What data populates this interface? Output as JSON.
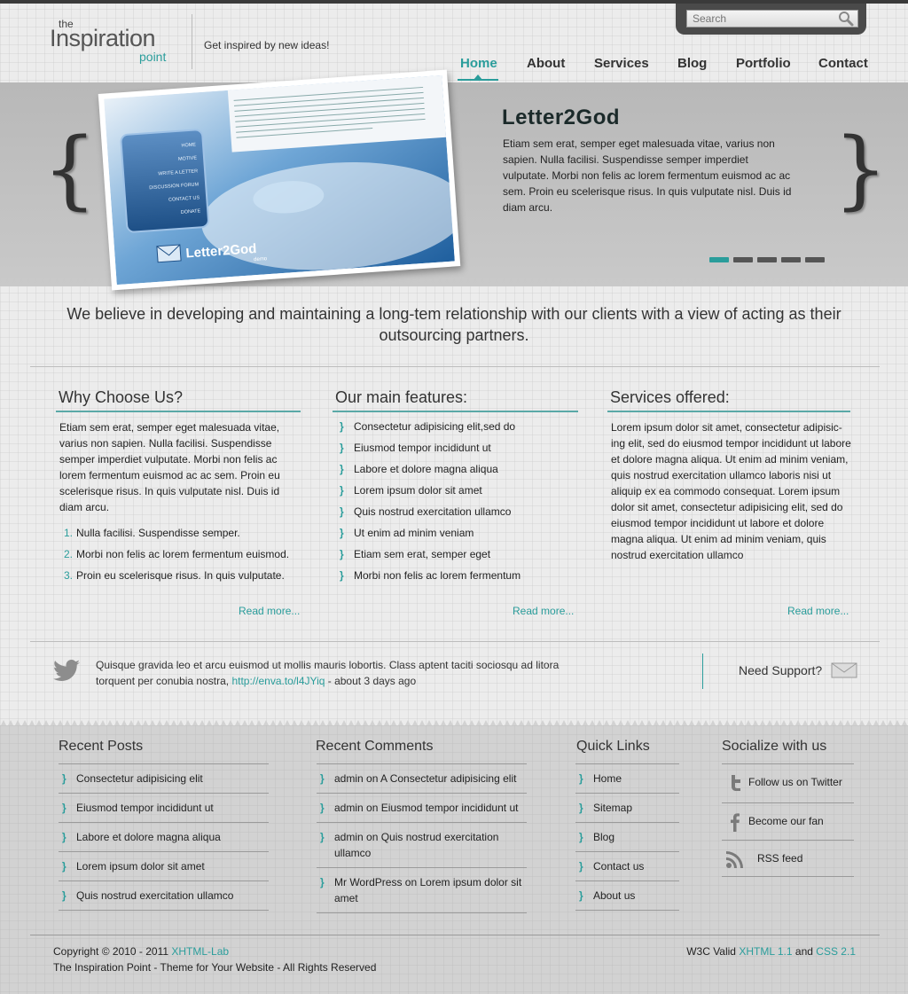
{
  "header": {
    "logo": {
      "the": "the",
      "main": "Inspiration",
      "sub": "point"
    },
    "tagline": "Get inspired by new ideas!",
    "search_placeholder": "Search"
  },
  "nav": [
    {
      "label": "Home",
      "active": true
    },
    {
      "label": "About"
    },
    {
      "label": "Services"
    },
    {
      "label": "Blog"
    },
    {
      "label": "Portfolio"
    },
    {
      "label": "Contact"
    }
  ],
  "slider": {
    "title": "Letter2God",
    "text": "Etiam sem erat, semper eget malesuada vitae, varius non sapien. Nulla facilisi. Suspendisse semper imperdiet vulputate. Morbi non felis ac lorem fermentum euismod ac ac sem. Proin eu scelerisque risus. In quis vulputate nisl. Duis id diam arcu.",
    "dots_count": 5,
    "active_dot": 1,
    "image": {
      "menu": [
        "HOME",
        "MOTIVE",
        "WRITE A LETTER",
        "DISCUSSION FORUM",
        "CONTACT US",
        "DONATE"
      ],
      "brand": "Letter2God",
      "brand_sub": "demo"
    }
  },
  "intro": "We believe in developing and maintaining a long-tem relationship with our clients with a view of acting as their outsourcing partners.",
  "columns": {
    "why": {
      "title": "Why Choose Us?",
      "text": "Etiam sem erat, semper eget malesuada vitae, varius non sapien. Nulla facilisi. Suspendisse semper imperdiet vulputate. Morbi non felis ac lorem fermentum euismod ac ac sem. Proin eu scelerisque risus. In quis vulputate nisl. Duis id diam arcu.",
      "list": [
        "Nulla facilisi. Suspendisse semper.",
        "Morbi non felis ac lorem fermentum euismod.",
        "Proin eu scelerisque risus. In quis vulputate."
      ],
      "read_more": "Read more..."
    },
    "features": {
      "title": "Our main features:",
      "list": [
        "Consectetur adipisicing elit,sed do",
        "Eiusmod tempor incididunt ut",
        "Labore et dolore magna aliqua",
        "Lorem ipsum dolor sit amet",
        "Quis nostrud exercitation ullamco",
        "Ut enim ad minim veniam",
        "Etiam sem erat, semper eget",
        "Morbi non felis ac lorem fermentum"
      ],
      "read_more": "Read more..."
    },
    "services": {
      "title": "Services offered:",
      "text": "Lorem ipsum dolor sit amet, consectetur adipisic-ing elit, sed do eiusmod tempor incididunt ut labore et dolore magna aliqua. Ut enim ad minim veniam, quis nostrud exercitation ullamco laboris nisi ut aliquip ex ea commodo consequat. Lorem ipsum dolor sit amet, consectetur adipisicing elit, sed do eiusmod tempor incididunt ut labore et dolore magna aliqua. Ut enim ad minim veniam, quis nostrud exercitation ullamco",
      "read_more": "Read more..."
    }
  },
  "tweet": {
    "text": "Quisque gravida leo et arcu euismod ut mollis mauris lobortis. Class aptent taciti sociosqu ad litora torquent per conubia nostra,",
    "link": "http://enva.to/l4JYiq",
    "time": "- about 3 days ago"
  },
  "support": {
    "label": "Need Support?"
  },
  "footer": {
    "recent_posts": {
      "title": "Recent Posts",
      "items": [
        "Consectetur adipisicing  elit",
        "Eiusmod tempor incididunt ut",
        "Labore et dolore magna aliqua",
        "Lorem ipsum dolor sit amet",
        "Quis nostrud exercitation ullamco"
      ]
    },
    "recent_comments": {
      "title": "Recent Comments",
      "items": [
        "admin on A Consectetur adipisicing  elit",
        "admin on Eiusmod tempor incididunt ut",
        "admin on Quis nostrud exercitation ullamco",
        "Mr WordPress on Lorem ipsum dolor sit amet"
      ]
    },
    "quick_links": {
      "title": "Quick Links",
      "items": [
        "Home",
        "Sitemap",
        "Blog",
        "Contact us",
        "About us"
      ]
    },
    "social": {
      "title": "Socialize with us",
      "items": [
        {
          "label": "Follow us on Twitter",
          "icon": "twitter-icon"
        },
        {
          "label": "Become our fan",
          "icon": "facebook-icon"
        },
        {
          "label": "RSS feed",
          "icon": "rss-icon"
        }
      ]
    },
    "copyright_prefix": "Copyright © 2010 - 2011",
    "copyright_link": "XHTML-Lab",
    "rights": "The Inspiration Point - Theme for Your Website - All Rights Reserved",
    "valid_prefix": "W3C Valid",
    "valid_xhtml": "XHTML 1.1",
    "valid_and": "and",
    "valid_css": "CSS 2.1"
  },
  "colors": {
    "accent": "#2a9d9b",
    "dark": "#3a3a3a",
    "slider_bg": "#bfbfbf"
  }
}
